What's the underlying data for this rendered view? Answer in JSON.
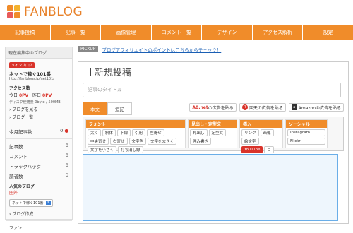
{
  "brand": {
    "logo_text": "FANBLOG"
  },
  "nav": {
    "items": [
      "記事投稿",
      "記事一覧",
      "画像管理",
      "コメント一覧",
      "デザイン",
      "アクセス解析",
      "設定"
    ]
  },
  "sidebar": {
    "heading": "現在編集中のブログ",
    "main_badge": "メインブログ",
    "blog_name": "ネットで稼ぐ101番",
    "blog_url": "http://fanblogs.jp/net101/",
    "access_label": "アクセス数",
    "today_label": "今日",
    "today_value": "0PV",
    "yesterday_label": "昨日",
    "yesterday_value": "0PV",
    "disk_usage": "ディスク使用量 0byte / 500MB",
    "view_blog": "› ブログを見る",
    "blog_list": "› ブログ一覧",
    "today_posts_label": "今月記事数",
    "today_posts_value": "0",
    "stats": [
      {
        "label": "記事数",
        "value": "0"
      },
      {
        "label": "コメント",
        "value": "0"
      },
      {
        "label": "トラックバック",
        "value": "0"
      },
      {
        "label": "読者数",
        "value": "0"
      }
    ],
    "popular_label": "人気のブログ",
    "popular_value": "圏外",
    "select_value": "ネットで稼ぐ101番",
    "create_blog": "› ブログ作成",
    "fan_label": "ファン"
  },
  "pickup": {
    "tag": "PICKUP",
    "link": "ブログアフィリエイトのポイントはこちらからチェック！"
  },
  "editor": {
    "title": "新規投稿",
    "title_placeholder": "記事のタイトル",
    "tabs": [
      "本文",
      "追記"
    ],
    "ads": [
      {
        "brand": "A8.net",
        "label": "の広告を貼る"
      },
      {
        "brand": "R",
        "label": "楽天の広告を貼る"
      },
      {
        "brand": "a",
        "label": "Amazonの広告を貼る"
      }
    ],
    "groups": {
      "font": {
        "title": "フォント",
        "buttons": [
          "太く",
          "斜体",
          "下線",
          "引用",
          "左寄せ",
          "中央寄せ",
          "右寄せ",
          "文字色",
          "文字を大きく",
          "文字を小さく",
          "打ち消し線"
        ]
      },
      "heading": {
        "title": "見出し・定型文",
        "buttons": [
          "見出し",
          "定型文",
          "囲み書き"
        ]
      },
      "insert": {
        "title": "挿入",
        "buttons": [
          "リンク",
          "画像",
          "絵文字",
          "YouTube",
          "こ"
        ]
      },
      "social": {
        "title": "ソーシャル",
        "buttons": [
          "Instagram",
          "Flickr"
        ]
      }
    }
  },
  "colors": {
    "accent": "#f08c2a",
    "red": "#d9332a",
    "link": "#1a5fb4"
  }
}
